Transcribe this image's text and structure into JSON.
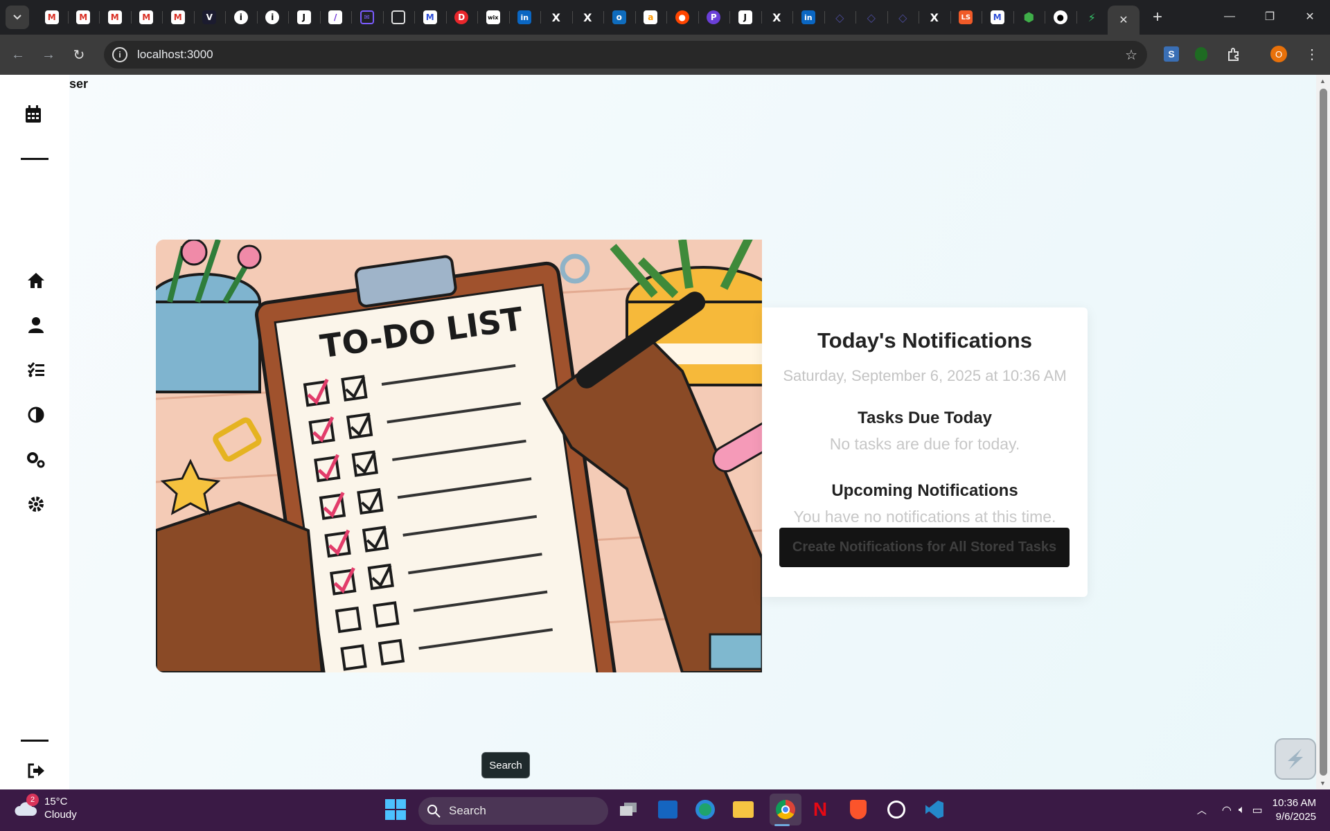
{
  "browser": {
    "pinned_tab_icons": [
      "gmail-icon",
      "gmail-icon",
      "gmail-icon",
      "gmail-icon",
      "gmail-icon",
      "v-icon",
      "info-icon",
      "info-icon",
      "j-icon",
      "slash-icon",
      "mail-icon",
      "square-icon",
      "m-icon",
      "d-icon",
      "wix-icon",
      "linkedin-icon",
      "x-icon",
      "x-icon",
      "outlook-icon",
      "amazon-icon",
      "reddit-icon",
      "p-icon",
      "j-icon",
      "x-icon",
      "linkedin-icon",
      "diamond-icon",
      "diamond-icon",
      "diamond-icon",
      "x-icon",
      "ls-icon",
      "m-icon",
      "hexagon-icon",
      "github-icon",
      "bolt-icon"
    ],
    "address": "localhost:3000",
    "profile_initial": "O"
  },
  "sidebar": {
    "user_label": "ser",
    "items": [
      "calendar-icon",
      "home-icon",
      "user-icon",
      "tasks-icon",
      "theme-icon",
      "cogs-icon",
      "settings-icon",
      "logout-icon"
    ]
  },
  "card": {
    "title": "Today's Notifications",
    "datetime": "Saturday, September 6, 2025 at 10:36 AM",
    "tasks_heading": "Tasks Due Today",
    "tasks_empty": "No tasks are due for today.",
    "upcoming_heading": "Upcoming Notifications",
    "upcoming_empty": "You have no notifications at this time.",
    "create_button": "Create Notifications for All Stored Tasks"
  },
  "hero": {
    "heading": "TO-DO LIST"
  },
  "tooltip": "Search",
  "taskbar": {
    "weather_badge": "2",
    "temperature": "15°C",
    "condition": "Cloudy",
    "search_label": "Search",
    "time": "10:36 AM",
    "date": "9/6/2025"
  }
}
